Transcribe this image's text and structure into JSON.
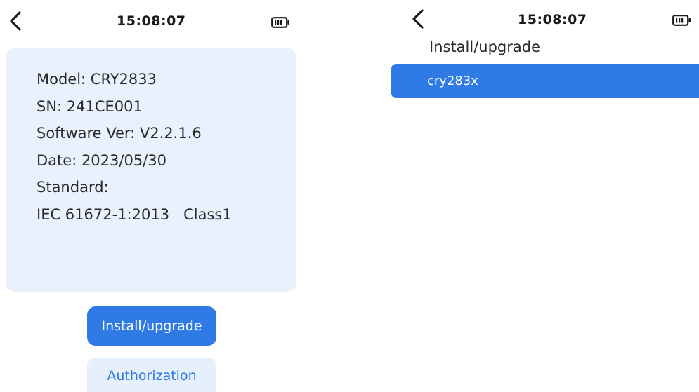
{
  "colors": {
    "accent": "#2f7ae5",
    "card_background": "#e8f1fd",
    "secondary_button_background": "#e6f0fc"
  },
  "left_screen": {
    "status": {
      "back_icon": "chevron-left-icon",
      "time": "15:08:07",
      "battery_icon": "battery-icon"
    },
    "info": {
      "model": "Model: CRY2833",
      "sn": "SN: 241CE001",
      "software_ver": "Software Ver: V2.2.1.6",
      "date": "Date: 2023/05/30",
      "standard_label": "Standard:",
      "standard_value": "IEC 61672-1:2013   Class1"
    },
    "buttons": {
      "install": "Install/upgrade",
      "authorization": "Authorization"
    }
  },
  "right_screen": {
    "status": {
      "back_icon": "chevron-left-icon",
      "time": "15:08:07",
      "battery_icon": "battery-icon"
    },
    "title": "Install/upgrade",
    "items": [
      {
        "label": "cry283x",
        "selected": true
      }
    ]
  }
}
